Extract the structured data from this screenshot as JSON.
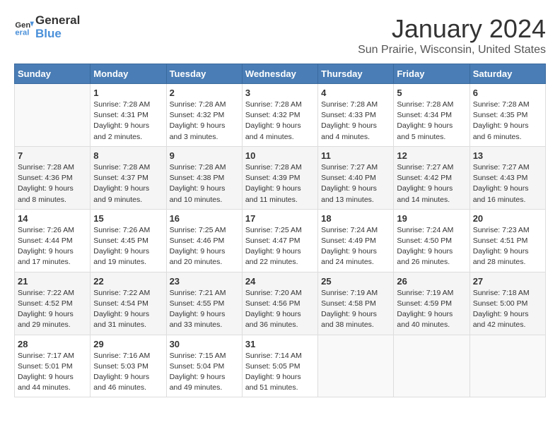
{
  "header": {
    "logo_line1": "General",
    "logo_line2": "Blue",
    "title": "January 2024",
    "subtitle": "Sun Prairie, Wisconsin, United States"
  },
  "columns": [
    "Sunday",
    "Monday",
    "Tuesday",
    "Wednesday",
    "Thursday",
    "Friday",
    "Saturday"
  ],
  "weeks": [
    [
      {
        "day": "",
        "info": ""
      },
      {
        "day": "1",
        "info": "Sunrise: 7:28 AM\nSunset: 4:31 PM\nDaylight: 9 hours\nand 2 minutes."
      },
      {
        "day": "2",
        "info": "Sunrise: 7:28 AM\nSunset: 4:32 PM\nDaylight: 9 hours\nand 3 minutes."
      },
      {
        "day": "3",
        "info": "Sunrise: 7:28 AM\nSunset: 4:32 PM\nDaylight: 9 hours\nand 4 minutes."
      },
      {
        "day": "4",
        "info": "Sunrise: 7:28 AM\nSunset: 4:33 PM\nDaylight: 9 hours\nand 4 minutes."
      },
      {
        "day": "5",
        "info": "Sunrise: 7:28 AM\nSunset: 4:34 PM\nDaylight: 9 hours\nand 5 minutes."
      },
      {
        "day": "6",
        "info": "Sunrise: 7:28 AM\nSunset: 4:35 PM\nDaylight: 9 hours\nand 6 minutes."
      }
    ],
    [
      {
        "day": "7",
        "info": "Sunrise: 7:28 AM\nSunset: 4:36 PM\nDaylight: 9 hours\nand 8 minutes."
      },
      {
        "day": "8",
        "info": "Sunrise: 7:28 AM\nSunset: 4:37 PM\nDaylight: 9 hours\nand 9 minutes."
      },
      {
        "day": "9",
        "info": "Sunrise: 7:28 AM\nSunset: 4:38 PM\nDaylight: 9 hours\nand 10 minutes."
      },
      {
        "day": "10",
        "info": "Sunrise: 7:28 AM\nSunset: 4:39 PM\nDaylight: 9 hours\nand 11 minutes."
      },
      {
        "day": "11",
        "info": "Sunrise: 7:27 AM\nSunset: 4:40 PM\nDaylight: 9 hours\nand 13 minutes."
      },
      {
        "day": "12",
        "info": "Sunrise: 7:27 AM\nSunset: 4:42 PM\nDaylight: 9 hours\nand 14 minutes."
      },
      {
        "day": "13",
        "info": "Sunrise: 7:27 AM\nSunset: 4:43 PM\nDaylight: 9 hours\nand 16 minutes."
      }
    ],
    [
      {
        "day": "14",
        "info": "Sunrise: 7:26 AM\nSunset: 4:44 PM\nDaylight: 9 hours\nand 17 minutes."
      },
      {
        "day": "15",
        "info": "Sunrise: 7:26 AM\nSunset: 4:45 PM\nDaylight: 9 hours\nand 19 minutes."
      },
      {
        "day": "16",
        "info": "Sunrise: 7:25 AM\nSunset: 4:46 PM\nDaylight: 9 hours\nand 20 minutes."
      },
      {
        "day": "17",
        "info": "Sunrise: 7:25 AM\nSunset: 4:47 PM\nDaylight: 9 hours\nand 22 minutes."
      },
      {
        "day": "18",
        "info": "Sunrise: 7:24 AM\nSunset: 4:49 PM\nDaylight: 9 hours\nand 24 minutes."
      },
      {
        "day": "19",
        "info": "Sunrise: 7:24 AM\nSunset: 4:50 PM\nDaylight: 9 hours\nand 26 minutes."
      },
      {
        "day": "20",
        "info": "Sunrise: 7:23 AM\nSunset: 4:51 PM\nDaylight: 9 hours\nand 28 minutes."
      }
    ],
    [
      {
        "day": "21",
        "info": "Sunrise: 7:22 AM\nSunset: 4:52 PM\nDaylight: 9 hours\nand 29 minutes."
      },
      {
        "day": "22",
        "info": "Sunrise: 7:22 AM\nSunset: 4:54 PM\nDaylight: 9 hours\nand 31 minutes."
      },
      {
        "day": "23",
        "info": "Sunrise: 7:21 AM\nSunset: 4:55 PM\nDaylight: 9 hours\nand 33 minutes."
      },
      {
        "day": "24",
        "info": "Sunrise: 7:20 AM\nSunset: 4:56 PM\nDaylight: 9 hours\nand 36 minutes."
      },
      {
        "day": "25",
        "info": "Sunrise: 7:19 AM\nSunset: 4:58 PM\nDaylight: 9 hours\nand 38 minutes."
      },
      {
        "day": "26",
        "info": "Sunrise: 7:19 AM\nSunset: 4:59 PM\nDaylight: 9 hours\nand 40 minutes."
      },
      {
        "day": "27",
        "info": "Sunrise: 7:18 AM\nSunset: 5:00 PM\nDaylight: 9 hours\nand 42 minutes."
      }
    ],
    [
      {
        "day": "28",
        "info": "Sunrise: 7:17 AM\nSunset: 5:01 PM\nDaylight: 9 hours\nand 44 minutes."
      },
      {
        "day": "29",
        "info": "Sunrise: 7:16 AM\nSunset: 5:03 PM\nDaylight: 9 hours\nand 46 minutes."
      },
      {
        "day": "30",
        "info": "Sunrise: 7:15 AM\nSunset: 5:04 PM\nDaylight: 9 hours\nand 49 minutes."
      },
      {
        "day": "31",
        "info": "Sunrise: 7:14 AM\nSunset: 5:05 PM\nDaylight: 9 hours\nand 51 minutes."
      },
      {
        "day": "",
        "info": ""
      },
      {
        "day": "",
        "info": ""
      },
      {
        "day": "",
        "info": ""
      }
    ]
  ]
}
